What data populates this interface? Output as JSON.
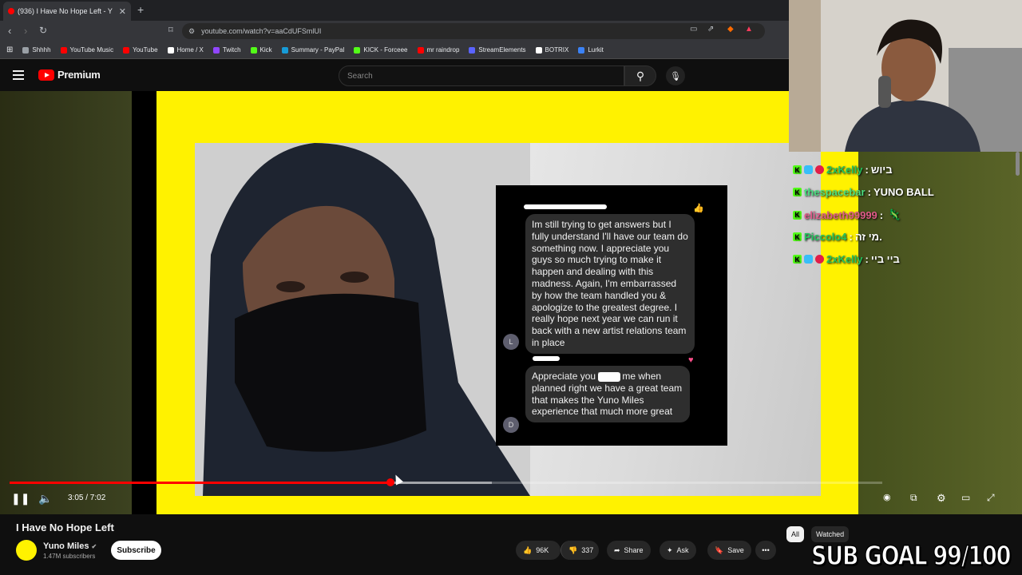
{
  "browser": {
    "tab_title": "(936) I Have No Hope Left - Y",
    "new_tab": "+",
    "url": "youtube.com/watch?v=aaCdUFSmlUI",
    "bookmarks": [
      {
        "label": "Shhhh",
        "color": "#9aa0a6"
      },
      {
        "label": "YouTube Music",
        "color": "#ff0000"
      },
      {
        "label": "YouTube",
        "color": "#ff0000"
      },
      {
        "label": "Home / X",
        "color": "#ffffff"
      },
      {
        "label": "Twitch",
        "color": "#9146ff"
      },
      {
        "label": "Kick",
        "color": "#53fc18"
      },
      {
        "label": "Summary - PayPal",
        "color": "#179bd7"
      },
      {
        "label": "KICK - Forceee",
        "color": "#53fc18"
      },
      {
        "label": "mr raindrop",
        "color": "#ff0000"
      },
      {
        "label": "StreamElements",
        "color": "#5a63ff"
      },
      {
        "label": "BOTRIX",
        "color": "#ffffff"
      },
      {
        "label": "Lurkit",
        "color": "#3b82f6"
      }
    ]
  },
  "youtube": {
    "logo_text": "Premium",
    "search_placeholder": "Search"
  },
  "video": {
    "chat_message_1": "Im still trying to get answers but I fully understand I'll have our team do something now. I appreciate you guys so much trying to make it happen and dealing with this madness. Again, I'm embarrassed by how the team handled you & apologize to the greatest degree. I really hope next year we can run it back with a new artist relations team in place",
    "chat_avatar_1": "L",
    "chat_message_2": "Appreciate you      Trust me when planned right we have a great team that makes the Yuno Miles experience that much more great",
    "chat_avatar_2": "D",
    "progress_fraction": 0.436,
    "time": "3:05 / 7:02"
  },
  "stream_chat": [
    {
      "user": "2xKelly",
      "message": "ביוש",
      "color": "#22c55e"
    },
    {
      "user": "thespacebar",
      "message": "YUNO BALL",
      "color": "#4ade80"
    },
    {
      "user": "elizabeth99999",
      "message": "",
      "color": "#e05a8a"
    },
    {
      "user": "Piccolo4",
      "message": "מי זה.",
      "color": "#22c55e"
    },
    {
      "user": "2xKelly",
      "message": "ביי ביי",
      "color": "#22c55e"
    }
  ],
  "below": {
    "title": "I Have No Hope Left",
    "channel": "Yuno Miles",
    "subscribers": "1.47M subscribers",
    "subscribe": "Subscribe",
    "likes": "96K",
    "dislikes": "337",
    "share": "Share",
    "ask": "Ask",
    "save": "Save",
    "more": "•••",
    "chip_all": "All",
    "chip_watched": "Watched"
  },
  "overlay": {
    "sub_goal": "SUB GOAL 99/100"
  }
}
